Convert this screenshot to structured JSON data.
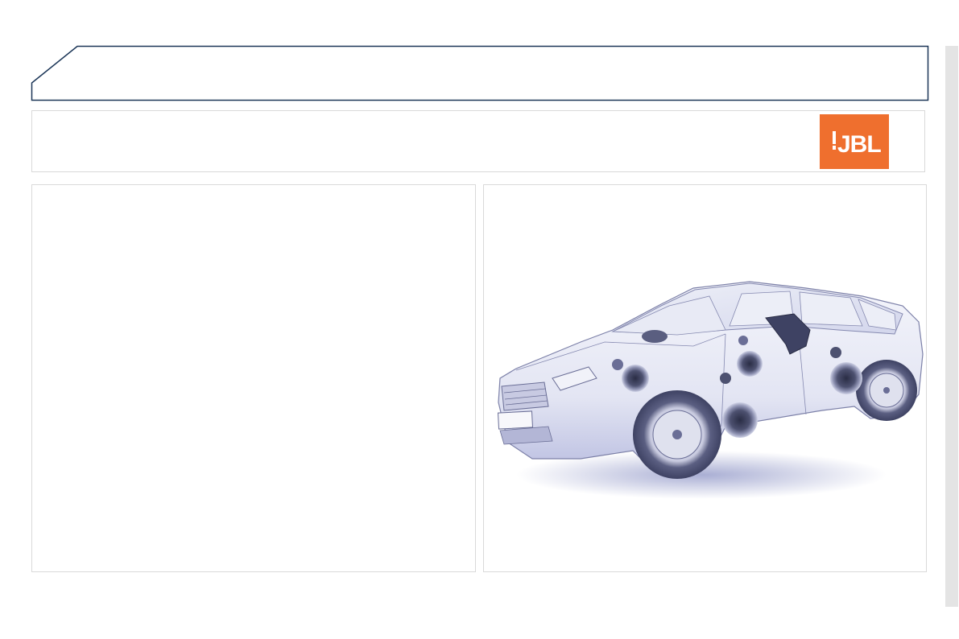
{
  "header": {
    "title": ""
  },
  "brand": {
    "logo_text": "JBL",
    "logo_bg": "#ef6f2e",
    "logo_fg": "#ffffff"
  },
  "colors": {
    "frame_line": "#1b3557",
    "panel_border": "#d9d9d9",
    "side_tab": "#e4e4e4",
    "car_tint": "#9aa0cc"
  },
  "content": {
    "left_panel_text": "",
    "right_panel_image": "car-speaker-layout-illustration"
  }
}
